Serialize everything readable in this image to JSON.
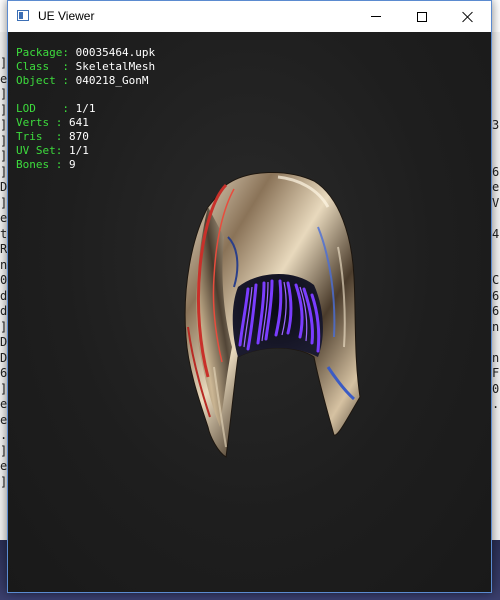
{
  "window": {
    "title": "UE Viewer",
    "icon": "app-window-icon",
    "controls": {
      "minimize_icon": "minimize-icon",
      "maximize_icon": "maximize-icon",
      "close_icon": "close-icon"
    }
  },
  "info": {
    "package": {
      "key": "Package",
      "value": "00035464.upk"
    },
    "class": {
      "key": "Class  ",
      "value": "SkeletalMesh"
    },
    "object": {
      "key": "Object ",
      "value": "040218_GonM"
    },
    "lod": {
      "key": "LOD   ",
      "value": "1/1"
    },
    "verts": {
      "key": "Verts ",
      "value": "641"
    },
    "tris": {
      "key": "Tris  ",
      "value": "870"
    },
    "uvset": {
      "key": "UV Set",
      "value": "1/1"
    },
    "bones": {
      "key": "Bones ",
      "value": "9"
    }
  },
  "background_console": {
    "left_chars": "]\ne\n]\n]\n]\n]\n]\n]\nD\n]\ne\nt\nR\nn\n0\nd\nd\n]\nD\nD\n6\n]\ne\ne\n.\n]\ne\n]",
    "right_chars": "3\n\n\n6\ne\nV\n\n4\n\n\nC\n6\n6\nn\n\nn\nF\n0\n."
  },
  "colors": {
    "info_key": "#3ddc3d",
    "info_value": "#ffffff",
    "viewport_bg": "#1e1e1e",
    "hood_purple": "#7a3cff"
  }
}
